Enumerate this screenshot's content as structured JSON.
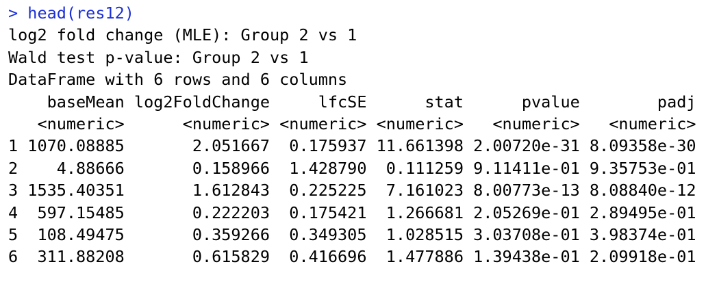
{
  "colors": {
    "background": "#ffffff",
    "input_text": "#1a2fd6",
    "output_text": "#000000"
  },
  "console": {
    "prompt_symbol": "> ",
    "command": "head(res12)",
    "info_lines": [
      "log2 fold change (MLE): Group 2 vs 1",
      "Wald test p-value: Group 2 vs 1",
      "DataFrame with 6 rows and 6 columns"
    ],
    "header_line": "    baseMean log2FoldChange     lfcSE      stat      pvalue        padj",
    "type_line": "   <numeric>      <numeric> <numeric> <numeric>   <numeric>   <numeric>",
    "rows": [
      "1 1070.08885       2.051667  0.175937 11.661398 2.00720e-31 8.09358e-30",
      "2    4.88666       0.158966  1.428790  0.111259 9.11411e-01 9.35753e-01",
      "3 1535.40351       1.612843  0.225225  7.161023 8.00773e-13 8.08840e-12",
      "4  597.15485       0.222203  0.175421  1.266681 2.05269e-01 2.89495e-01",
      "5  108.49475       0.359266  0.349305  1.028515 3.03708e-01 3.98374e-01",
      "6  311.88208       0.615829  0.416696  1.477886 1.39438e-01 2.09918e-01"
    ]
  }
}
